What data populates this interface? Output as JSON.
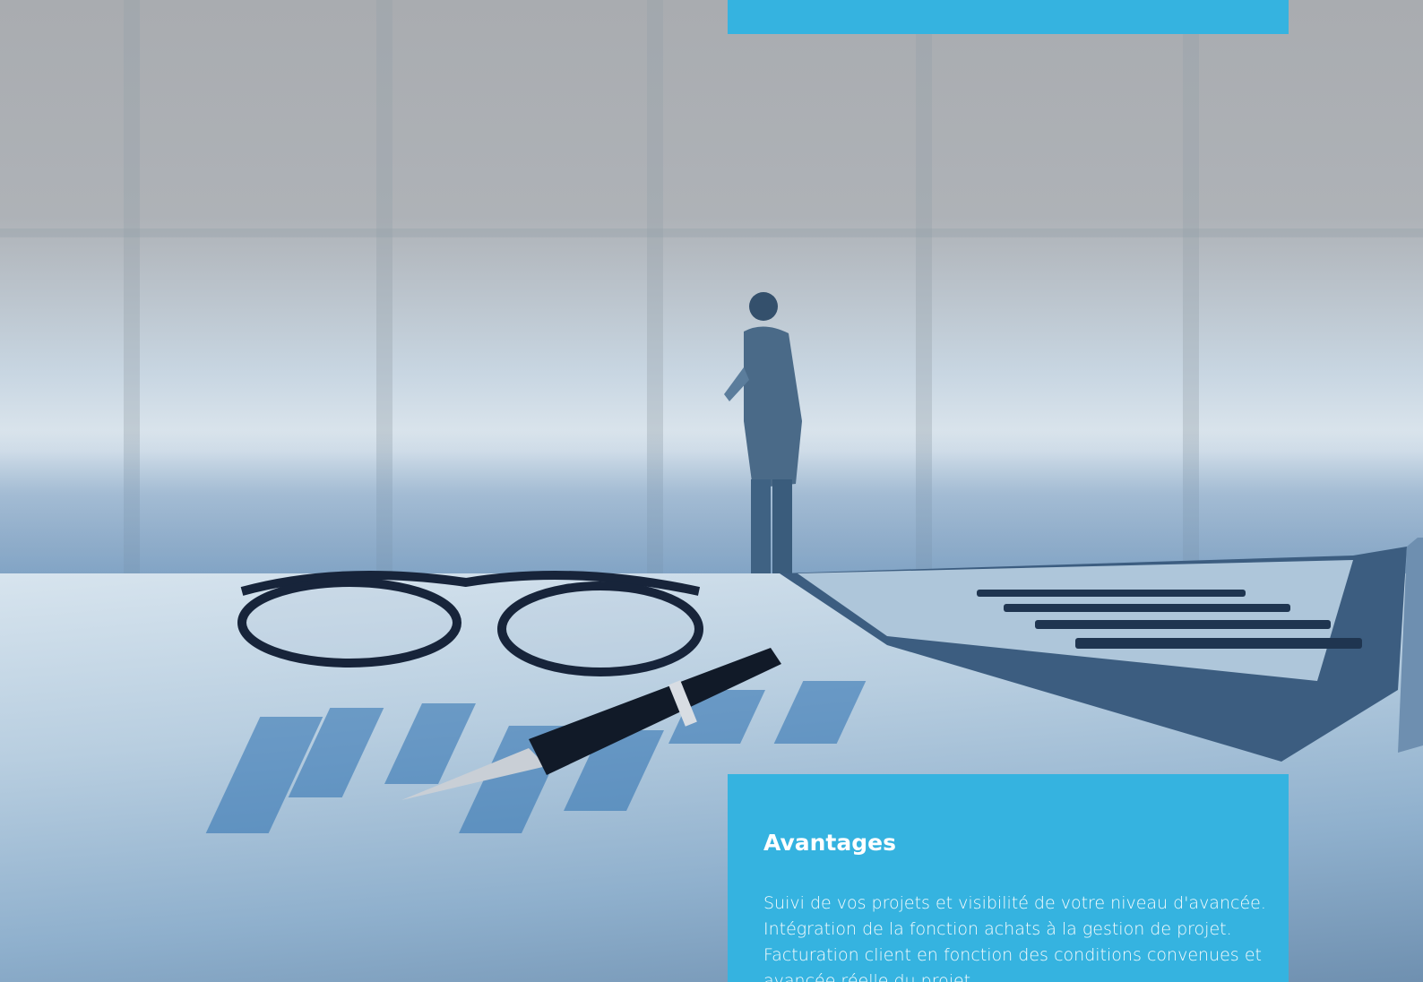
{
  "colors": {
    "panel_blue": "#35b3e0",
    "text_white": "#ffffff"
  },
  "hero": {
    "background_description_icon": "office-photo-background"
  },
  "info_panel": {
    "title": "Avantages",
    "lines": [
      "Suivi de vos projets et visibilité de votre niveau d'avancée.",
      "Intégration de la fonction achats à la gestion de projet.",
      " Facturation client en fonction des conditions convenues et avancée réelle du projet."
    ]
  }
}
